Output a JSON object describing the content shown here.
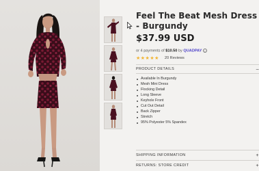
{
  "product": {
    "title": "Feel The Beat Mesh Dress - Burgundy",
    "price": "$37.99 USD",
    "installments": {
      "prefix": "or 4 payments of",
      "amount": "$10.50",
      "by": "by",
      "provider": "QUADPAY",
      "info": "i"
    },
    "rating": {
      "stars": "★★★★★",
      "value": 5,
      "max": 5,
      "reviews": "20 Reviews"
    }
  },
  "sections": {
    "details": {
      "header": "PRODUCT DETAILS",
      "toggle": "–",
      "items": [
        "Available In Burgundy",
        "Mesh Mini Dress",
        "Flocking Detail",
        "Long Sleeve",
        "Keyhole Front",
        "Cut Out Detail",
        "Back Zipper",
        "Stretch",
        "95% Polyester 5% Spandex"
      ]
    },
    "shipping": {
      "header": "SHIPPING INFORMATION",
      "toggle": "+"
    },
    "returns": {
      "header": "RETURNS: STORE CREDIT",
      "toggle": "+"
    }
  },
  "colors": {
    "dress": "#4a1020",
    "flocking": "#7a1a33",
    "star": "#f2b431",
    "quadpay": "#4a3fc8"
  },
  "icons": {
    "cursor": "mouse-pointer-icon",
    "info": "info-circle-icon",
    "star": "star-icon"
  }
}
